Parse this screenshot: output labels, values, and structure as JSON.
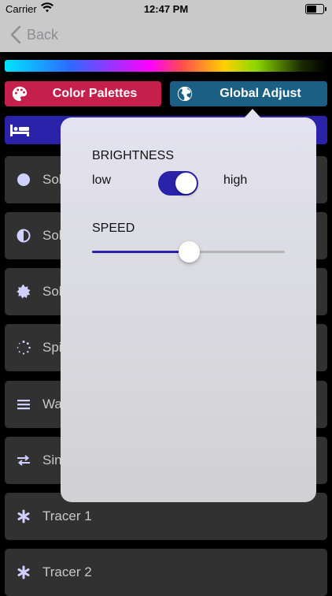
{
  "status_bar": {
    "carrier": "Carrier",
    "time": "12:47 PM"
  },
  "nav": {
    "back_label": "Back"
  },
  "tabs": {
    "palettes_label": "Color Palettes",
    "global_label": "Global Adjust"
  },
  "modes": [
    {
      "label": "Sol",
      "icon": "circle-filled-icon"
    },
    {
      "label": "Sol",
      "icon": "half-circle-icon"
    },
    {
      "label": "Sol",
      "icon": "burst-icon"
    },
    {
      "label": "Spi",
      "icon": "dotted-circle-icon"
    },
    {
      "label": "Wa",
      "icon": "lines-icon"
    },
    {
      "label": "Sin",
      "icon": "arrows-swap-icon"
    },
    {
      "label": "Tracer 1",
      "icon": "asterisk-icon"
    },
    {
      "label": "Tracer 2",
      "icon": "asterisk-icon"
    }
  ],
  "popover": {
    "brightness_title": "BRIGHTNESS",
    "low_label": "low",
    "high_label": "high",
    "brightness_high": true,
    "speed_title": "SPEED",
    "speed_value": 0.5
  },
  "colors": {
    "accent": "#2a23a9",
    "palettes_tab": "#c51f4c",
    "global_tab": "#1c5f84",
    "list_item": "#313131"
  }
}
